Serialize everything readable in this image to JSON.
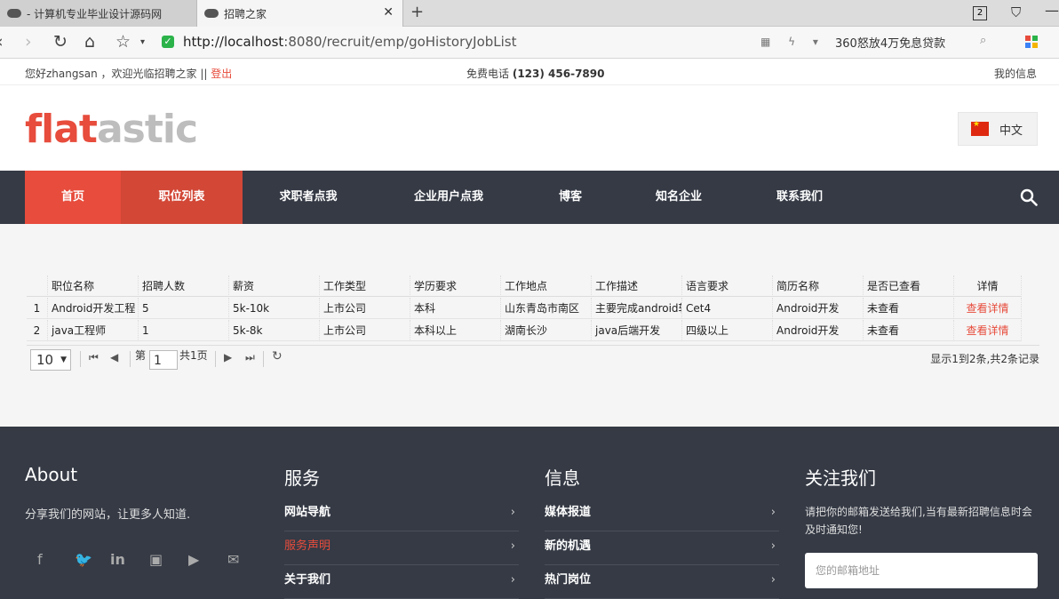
{
  "browser": {
    "tabs": [
      {
        "label": "- 计算机专业毕业设计源码网"
      },
      {
        "label": "招聘之家"
      }
    ],
    "tab_count": "2",
    "url_host": "http://localhost",
    "url_path": ":8080/recruit/emp/goHistoryJobList",
    "promo": "360怒放4万免息贷款"
  },
  "topbar": {
    "greeting": "您好zhangsan ，欢迎光临招聘之家 ||",
    "logout": "登出",
    "phone_label": "免费电话",
    "phone": "(123) 456-7890",
    "my_info": "我的信息"
  },
  "header": {
    "logo_part1": "flat",
    "logo_part2": "astic",
    "language": "中文"
  },
  "nav": {
    "items": [
      {
        "label": "首页"
      },
      {
        "label": "职位列表"
      },
      {
        "label": "求职者点我"
      },
      {
        "label": "企业用户点我"
      },
      {
        "label": "博客"
      },
      {
        "label": "知名企业"
      },
      {
        "label": "联系我们"
      }
    ]
  },
  "table": {
    "headers": [
      "职位名称",
      "招聘人数",
      "薪资",
      "工作类型",
      "学历要求",
      "工作地点",
      "工作描述",
      "语言要求",
      "简历名称",
      "是否已查看",
      "详情"
    ],
    "rows": [
      {
        "num": "1",
        "cells": [
          "Android开发工程",
          "5",
          "5k-10k",
          "上市公司",
          "本科",
          "山东青岛市南区",
          "主要完成android软",
          "Cet4",
          "Android开发",
          "未查看",
          "查看详情"
        ]
      },
      {
        "num": "2",
        "cells": [
          "java工程师",
          "1",
          "5k-8k",
          "上市公司",
          "本科以上",
          "湖南长沙",
          "java后端开发",
          "四级以上",
          "Android开发",
          "未查看",
          "查看详情"
        ]
      }
    ]
  },
  "pager": {
    "page_size": "10",
    "page_label": "第",
    "page": "1",
    "total_pages": "共1页",
    "info": "显示1到2条,共2条记录"
  },
  "footer": {
    "about_title": "About",
    "about_text": "分享我们的网站，让更多人知道.",
    "services_title": "服务",
    "services": [
      {
        "label": "网站导航"
      },
      {
        "label": "服务声明"
      },
      {
        "label": "关于我们"
      }
    ],
    "info_title": "信息",
    "info": [
      {
        "label": "媒体报道"
      },
      {
        "label": "新的机遇"
      },
      {
        "label": "热门岗位"
      }
    ],
    "follow_title": "关注我们",
    "follow_text": "请把你的邮箱发送给我们,当有最新招聘信息时会及时通知您!",
    "email_placeholder": "您的邮箱地址"
  },
  "colors": {
    "accent": "#e74c3c",
    "nav_bg": "#353a45",
    "footer_bg": "#353a45",
    "content_bg": "#f5f5f5"
  }
}
